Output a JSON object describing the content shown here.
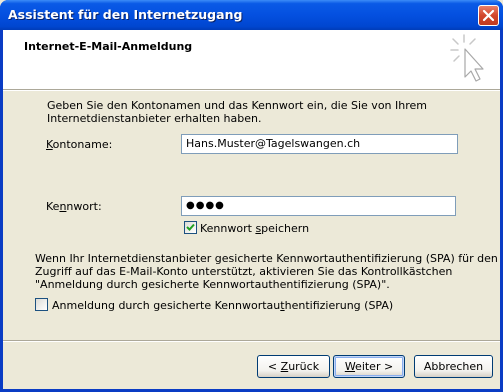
{
  "window": {
    "title": "Assistent für den Internetzugang",
    "close_icon": "close-icon"
  },
  "header": {
    "title": "Internet-E-Mail-Anmeldung",
    "icon": "wizard-sparkle-cursor-icon"
  },
  "intro": {
    "line1": "Geben Sie den Kontonamen und das Kennwort ein, die Sie von Ihrem",
    "line2": "Internetdienstanbieter erhalten haben."
  },
  "account": {
    "label_pre": "",
    "label_accel": "K",
    "label_post": "ontoname:",
    "value": "Hans.Muster@Tagelswangen.ch"
  },
  "password": {
    "label_pre": "Ke",
    "label_accel": "n",
    "label_post": "nwort:",
    "masked_value": "●●●●"
  },
  "save_password": {
    "checked": true,
    "label_pre": "Kennwort ",
    "label_accel": "s",
    "label_post": "peichern"
  },
  "spa_info": {
    "line1": "Wenn Ihr Internetdienstanbieter gesicherte Kennwortauthentifizierung (SPA) für den",
    "line2": "Zugriff auf das E-Mail-Konto unterstützt, aktivieren Sie das Kontrollkästchen",
    "line3": "\"Anmeldung durch gesicherte Kennwortauthentifizierung (SPA)\"."
  },
  "spa_checkbox": {
    "checked": false,
    "label_pre": "Anmeldung durch gesicherte Kennwortau",
    "label_accel": "t",
    "label_post": "hentifizierung (SPA)"
  },
  "buttons": {
    "back_pre": "< ",
    "back_accel": "Z",
    "back_post": "urück",
    "next_accel": "W",
    "next_post": "eiter >",
    "cancel": "Abbrechen"
  }
}
